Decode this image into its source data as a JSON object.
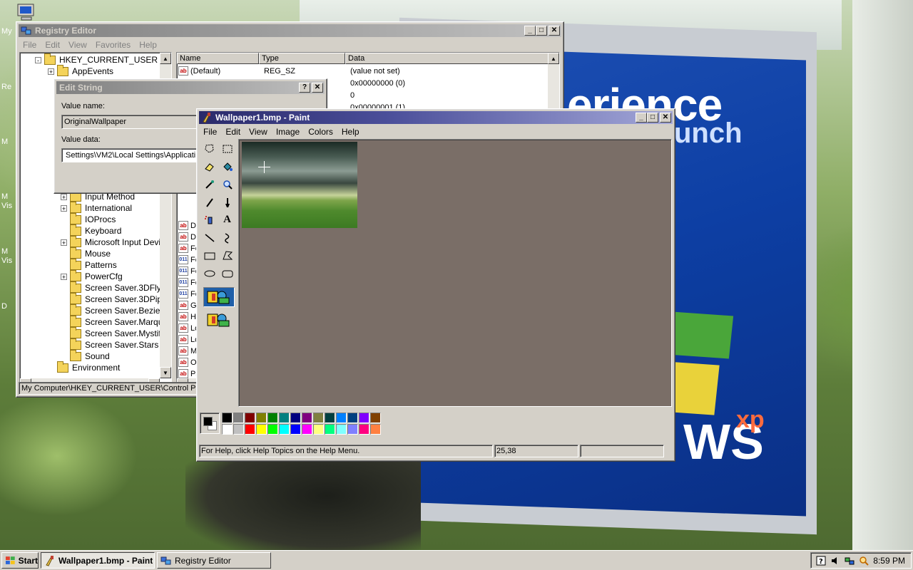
{
  "desktop": {
    "billboard_line1": "erience",
    "billboard_line2": "unch",
    "billboard_line3": "WS",
    "billboard_xp": "xp",
    "side_labels": [
      "My",
      "Re",
      "M",
      "M",
      "Vis",
      "M",
      "Vis",
      "D"
    ]
  },
  "regedit": {
    "title": "Registry Editor",
    "menu": [
      "File",
      "Edit",
      "View",
      "Favorites",
      "Help"
    ],
    "tree": [
      {
        "label": "HKEY_CURRENT_USER",
        "level": 1,
        "expander": "-"
      },
      {
        "label": "AppEvents",
        "level": 2,
        "expander": "+"
      },
      {
        "label": "Input Method",
        "level": 3,
        "expander": "+"
      },
      {
        "label": "International",
        "level": 3,
        "expander": "+"
      },
      {
        "label": "IOProcs",
        "level": 3,
        "expander": ""
      },
      {
        "label": "Keyboard",
        "level": 3,
        "expander": ""
      },
      {
        "label": "Microsoft Input Devices",
        "level": 3,
        "expander": "+"
      },
      {
        "label": "Mouse",
        "level": 3,
        "expander": ""
      },
      {
        "label": "Patterns",
        "level": 3,
        "expander": ""
      },
      {
        "label": "PowerCfg",
        "level": 3,
        "expander": "+"
      },
      {
        "label": "Screen Saver.3DFlyingO",
        "level": 3,
        "expander": ""
      },
      {
        "label": "Screen Saver.3DPipes",
        "level": 3,
        "expander": ""
      },
      {
        "label": "Screen Saver.Bezier",
        "level": 3,
        "expander": ""
      },
      {
        "label": "Screen Saver.Marquee",
        "level": 3,
        "expander": ""
      },
      {
        "label": "Screen Saver.Mystify",
        "level": 3,
        "expander": ""
      },
      {
        "label": "Screen Saver.Stars",
        "level": 3,
        "expander": ""
      },
      {
        "label": "Sound",
        "level": 3,
        "expander": ""
      },
      {
        "label": "Environment",
        "level": 2,
        "expander": ""
      }
    ],
    "columns": [
      "Name",
      "Type",
      "Data"
    ],
    "rows": [
      {
        "icon": "ab",
        "name": "(Default)",
        "type": "REG_SZ",
        "data": "(value not set)"
      },
      {
        "icon": "",
        "name": "",
        "type": "",
        "data": "0x00000000 (0)"
      },
      {
        "icon": "",
        "name": "",
        "type": "",
        "data": "0"
      },
      {
        "icon": "",
        "name": "",
        "type": "",
        "data": "0x00000001 (1)"
      }
    ],
    "partial_rows": [
      {
        "icon": "ab",
        "name": "D"
      },
      {
        "icon": "ab",
        "name": "D"
      },
      {
        "icon": "ab",
        "name": "Fo"
      },
      {
        "icon": "bin",
        "name": "Fo"
      },
      {
        "icon": "bin",
        "name": "Fo"
      },
      {
        "icon": "bin",
        "name": "Fo"
      },
      {
        "icon": "bin",
        "name": "Fo"
      },
      {
        "icon": "ab",
        "name": "G"
      },
      {
        "icon": "ab",
        "name": "H"
      },
      {
        "icon": "ab",
        "name": "Lo"
      },
      {
        "icon": "ab",
        "name": "Lo"
      },
      {
        "icon": "ab",
        "name": "M"
      },
      {
        "icon": "ab",
        "name": "O"
      },
      {
        "icon": "ab",
        "name": "Pa"
      }
    ],
    "status": "My Computer\\HKEY_CURRENT_USER\\Control Pa"
  },
  "edit_string": {
    "title": "Edit String",
    "value_name_label": "Value name:",
    "value_name": "OriginalWallpaper",
    "value_data_label": "Value data:",
    "value_data": "Settings\\VM2\\Local Settings\\Applicati"
  },
  "paint": {
    "title": "Wallpaper1.bmp - Paint",
    "menu": [
      "File",
      "Edit",
      "View",
      "Image",
      "Colors",
      "Help"
    ],
    "status_help": "For Help, click Help Topics on the Help Menu.",
    "status_coords": "25,38",
    "status_size": "",
    "tools": [
      "free-select",
      "select",
      "eraser",
      "fill",
      "color-picker",
      "magnifier",
      "pencil",
      "brush",
      "airbrush",
      "text",
      "line",
      "curve",
      "rectangle",
      "polygon",
      "ellipse",
      "rounded-rectangle"
    ],
    "palette_top": [
      "#000000",
      "#808080",
      "#800000",
      "#808000",
      "#008000",
      "#008080",
      "#000080",
      "#800080",
      "#808040",
      "#004040",
      "#0080ff",
      "#004080",
      "#8000ff",
      "#804000"
    ],
    "palette_bottom": [
      "#ffffff",
      "#c0c0c0",
      "#ff0000",
      "#ffff00",
      "#00ff00",
      "#00ffff",
      "#0000ff",
      "#ff00ff",
      "#ffff80",
      "#00ff80",
      "#80ffff",
      "#8080ff",
      "#ff0080",
      "#ff8040"
    ],
    "foreground": "#000000",
    "background": "#ffffff"
  },
  "taskbar": {
    "start_label": "Start",
    "tasks": [
      {
        "label": "Wallpaper1.bmp - Paint",
        "active": true
      },
      {
        "label": "Registry Editor",
        "active": false
      }
    ],
    "clock": "8:59 PM"
  }
}
